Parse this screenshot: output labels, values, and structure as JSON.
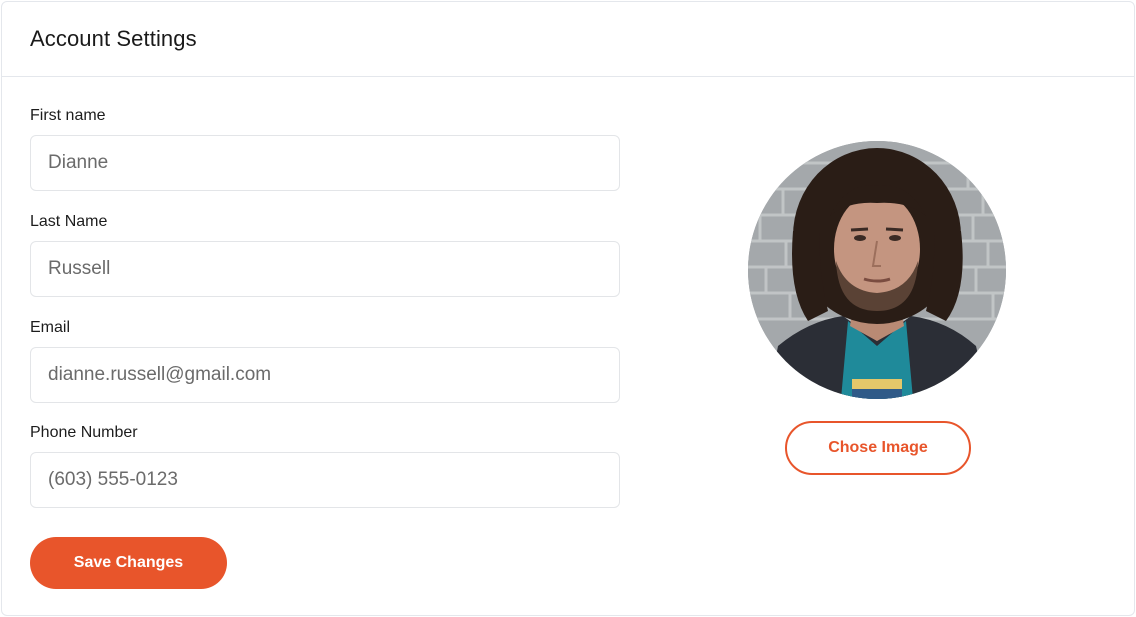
{
  "header": {
    "title": "Account Settings"
  },
  "form": {
    "first_name_label": "First name",
    "first_name_value": "Dianne",
    "last_name_label": "Last Name",
    "last_name_value": "Russell",
    "email_label": "Email",
    "email_value": "dianne.russell@gmail.com",
    "phone_label": "Phone Number",
    "phone_value": "(603) 555-0123",
    "save_label": "Save Changes"
  },
  "profile": {
    "avatar_icon": "profile-photo",
    "choose_image_label": "Chose Image"
  },
  "colors": {
    "accent": "#e8552b",
    "border": "#e4e7ec",
    "text": "#1d1d1d",
    "input_text": "#6b6b6b"
  }
}
